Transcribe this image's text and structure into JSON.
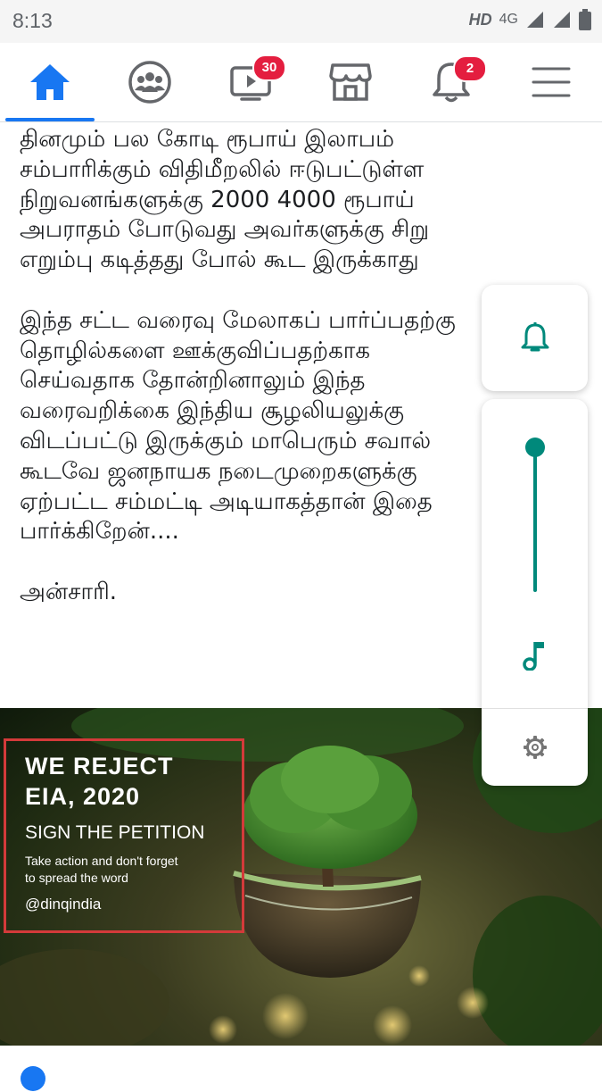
{
  "status_bar": {
    "time": "8:13",
    "hd": "HD",
    "network": "4G"
  },
  "nav": {
    "items": [
      {
        "name": "home",
        "active": true
      },
      {
        "name": "groups"
      },
      {
        "name": "watch",
        "badge": "30"
      },
      {
        "name": "marketplace"
      },
      {
        "name": "notifications",
        "badge": "2"
      },
      {
        "name": "menu"
      }
    ],
    "accent": "#1877f2",
    "badge_color": "#e41e3f"
  },
  "post": {
    "lines": [
      "தினமும் பல கோடி ரூபாய் இலாபம்",
      "சம்பாரிக்கும் விதிமீறலில் ஈடுபட்டுள்ள",
      "நிறுவனங்களுக்கு 2000 4000 ரூபாய்",
      "அபராதம் போடுவது அவர்களுக்கு சிறு",
      "எறும்பு கடித்தது போல் கூட இருக்காது",
      "",
      "இந்த சட்ட வரைவு மேலாகப் பார்ப்பதற்கு",
      "தொழில்களை ஊக்குவிப்பதற்காக",
      "செய்வதாக தோன்றினாலும் இந்த",
      "வரைவறிக்கை இந்திய சூழலியலுக்கு",
      "விடப்பட்டு இருக்கும் மாபெரும் சவால்",
      "கூடவே ஜனநாயக நடைமுறைகளுக்கு",
      "ஏற்பட்ட சம்மட்டி அடியாகத்தான் இதை",
      "பார்க்கிறேன்....",
      "",
      "அன்சாரி."
    ]
  },
  "image": {
    "headline_1": "WE REJECT",
    "headline_2": "EIA, 2020",
    "subhead": "SIGN THE PETITION",
    "body_1": "Take action and don't forget",
    "body_2": "to spread the word",
    "handle": "@dinqindia",
    "frame_color": "#d33a3a"
  },
  "volume_panel": {
    "icons": [
      "bell-icon",
      "music-note-icon",
      "gear-icon"
    ],
    "level": 1.0,
    "accent": "#00897b"
  }
}
